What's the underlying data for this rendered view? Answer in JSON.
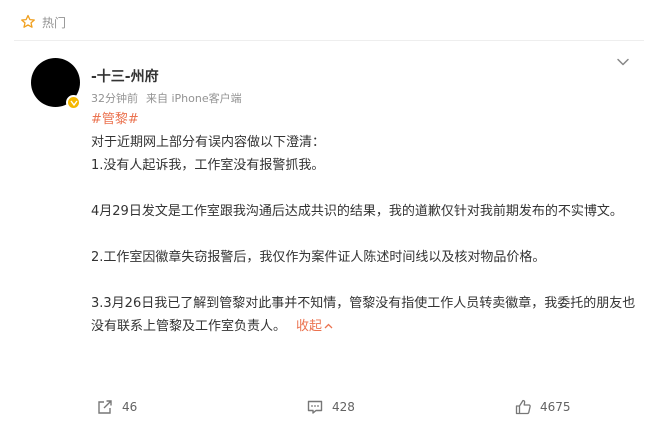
{
  "header": {
    "label": "热门",
    "icon": "star-icon"
  },
  "post": {
    "author": "-十三-州府",
    "time": "32分钟前",
    "source": "来自 iPhone客户端",
    "hashtag": "#管黎#",
    "paragraphs": [
      "对于近期网上部分有误内容做以下澄清：",
      "1.没有人起诉我，工作室没有报警抓我。",
      "",
      "4月29日发文是工作室跟我沟通后达成共识的结果，我的道歉仅针对我前期发布的不实博文。",
      "",
      "2.工作室因徽章失窃报警后，我仅作为案件证人陈述时间线以及核对物品价格。",
      "",
      "3.3月26日我已了解到管黎对此事并不知情，管黎没有指使工作人员转卖徽章，我委托的朋友也没有联系上管黎及工作室负责人。"
    ],
    "collapse_label": "收起",
    "verified_badge_color": "#f5b800"
  },
  "actions": {
    "repost_count": "46",
    "comment_count": "428",
    "like_count": "4675"
  },
  "colors": {
    "accent": "#eb7350",
    "meta": "#939393"
  }
}
